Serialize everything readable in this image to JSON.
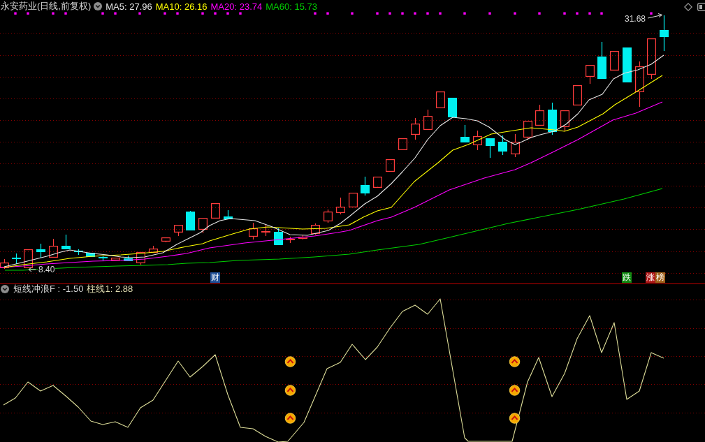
{
  "main_chart": {
    "title": "永安药业(日线,前复权)",
    "legend": [
      {
        "label": "MA5: 27.96",
        "color": "#e6e6e6"
      },
      {
        "label": "MA10: 26.16",
        "color": "#ffff00"
      },
      {
        "label": "MA20: 23.74",
        "color": "#ff00ff"
      },
      {
        "label": "MA60: 15.73",
        "color": "#00d000"
      }
    ],
    "high_label": "31.68",
    "low_label": "8.40",
    "badges": [
      {
        "text": "财",
        "color": "#1f4f96"
      },
      {
        "text": "跌",
        "color": "#118a11"
      },
      {
        "text": "涨",
        "color": "#b01818"
      },
      {
        "text": "榜",
        "color": "#a0601a"
      }
    ]
  },
  "indicator_panel": {
    "legend": [
      {
        "label": "短线冲浪F : -1.50",
        "color": "#d6d6d6"
      },
      {
        "label": "柱线1: 2.88",
        "color": "#e0dcb0"
      }
    ]
  }
}
